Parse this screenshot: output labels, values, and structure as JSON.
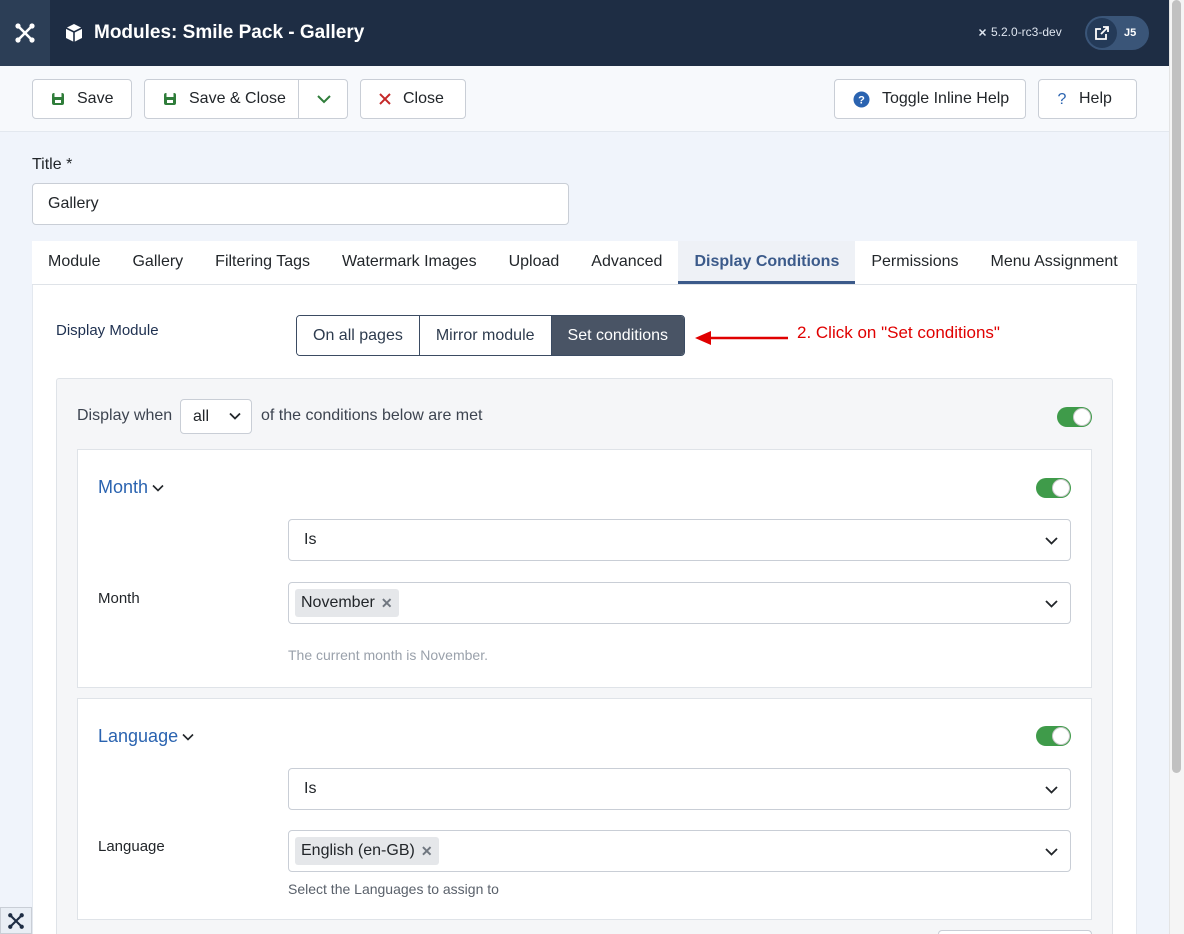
{
  "header": {
    "title": "Modules: Smile Pack - Gallery",
    "version": "5.2.0-rc3-dev",
    "user_badge": "J5",
    "logo_icon": "joomla-icon",
    "title_icon": "cube-icon",
    "external_icon": "external-link-icon"
  },
  "toolbar": {
    "save_label": "Save",
    "save_close_label": "Save & Close",
    "close_label": "Close",
    "toggle_help_label": "Toggle Inline Help",
    "help_label": "Help"
  },
  "title_field": {
    "label": "Title *",
    "value": "Gallery"
  },
  "tabs": [
    {
      "label": "Module",
      "active": false
    },
    {
      "label": "Gallery",
      "active": false
    },
    {
      "label": "Filtering Tags",
      "active": false
    },
    {
      "label": "Watermark Images",
      "active": false
    },
    {
      "label": "Upload",
      "active": false
    },
    {
      "label": "Advanced",
      "active": false
    },
    {
      "label": "Display Conditions",
      "active": true
    },
    {
      "label": "Permissions",
      "active": false
    },
    {
      "label": "Menu Assignment",
      "active": false
    }
  ],
  "display_module": {
    "label": "Display Module",
    "options": [
      "On all pages",
      "Mirror module",
      "Set conditions"
    ],
    "selected": "Set conditions"
  },
  "annotation": {
    "text": "2. Click on \"Set conditions\"",
    "color": "#e00000"
  },
  "conditions": {
    "display_when_prefix": "Display when",
    "display_when_value": "all",
    "display_when_suffix": "of the conditions below are met",
    "enabled": true,
    "month": {
      "title": "Month",
      "enabled": true,
      "operator": "Is",
      "field_label": "Month",
      "chips": [
        "November"
      ],
      "help": "The current month is November."
    },
    "language": {
      "title": "Language",
      "enabled": true,
      "operator": "Is",
      "field_label": "Language",
      "chips": [
        "English (en-GB)"
      ],
      "help": "Select the Languages to assign to"
    }
  },
  "colors": {
    "header_bg": "#1e2d44",
    "accent": "#3b5a8a",
    "toggle_on": "#3f9b4a",
    "link_blue": "#2a63b0"
  }
}
